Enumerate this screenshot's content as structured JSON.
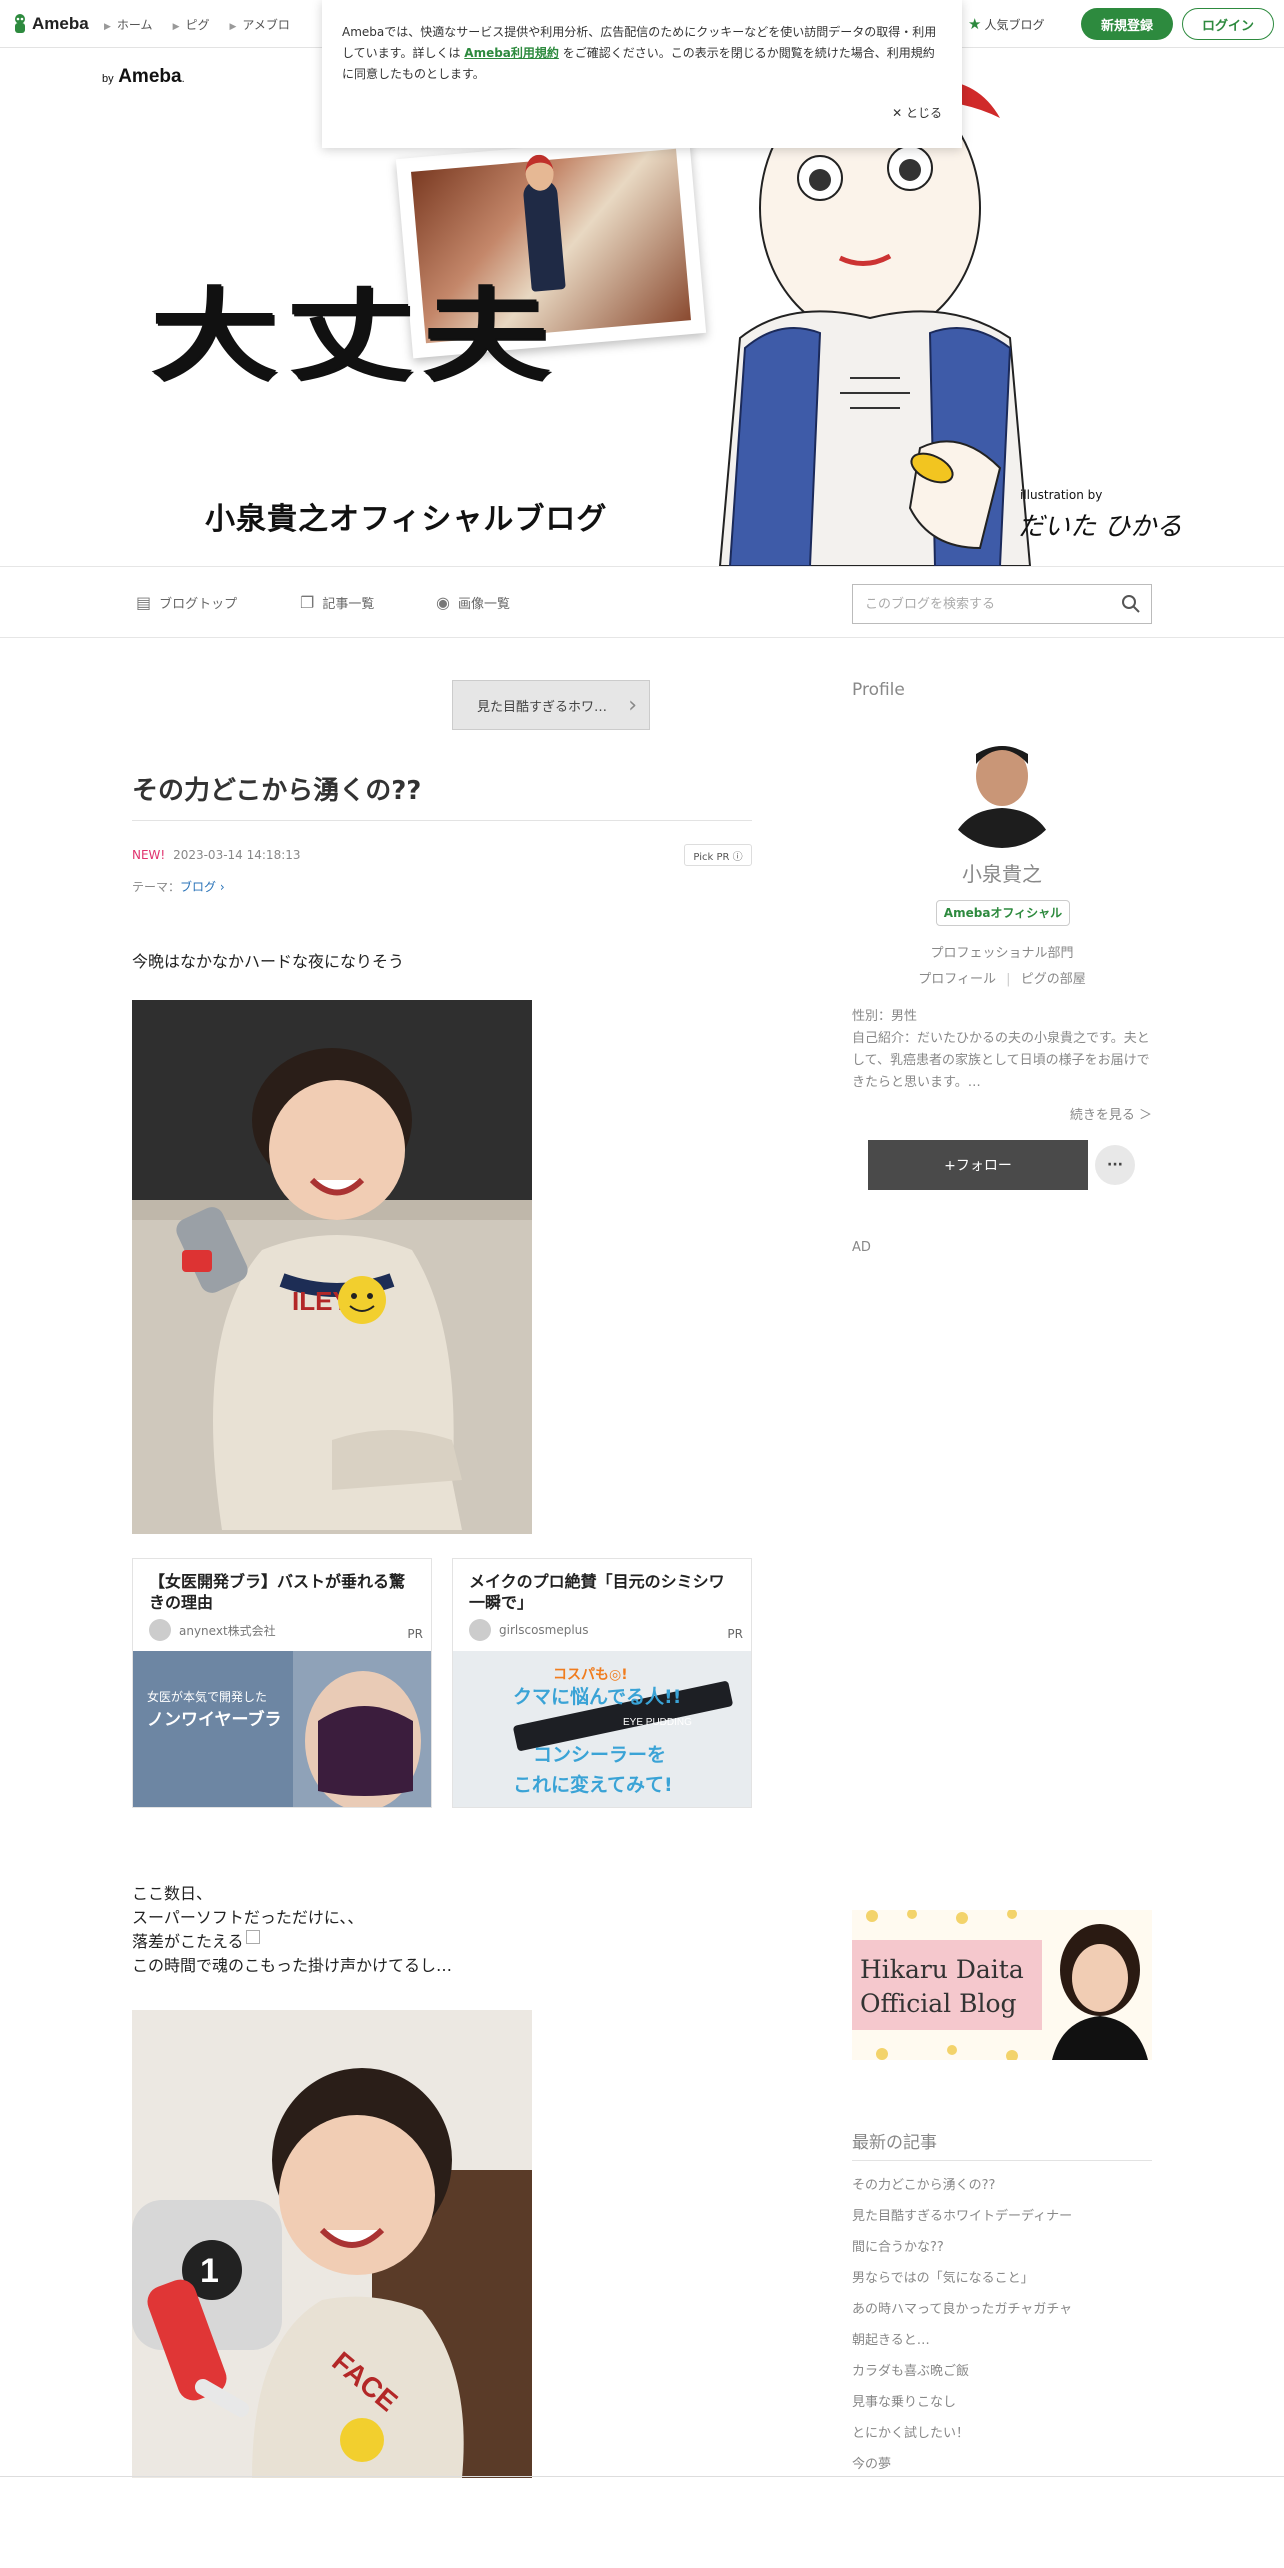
{
  "global_header": {
    "logo": "Ameba",
    "nav": [
      "ホーム",
      "ピグ",
      "アメブロ"
    ],
    "popular": "人気ブログ",
    "register": "新規登録",
    "login": "ログイン"
  },
  "cookie": {
    "text_before": "Amebaでは、快適なサービス提供や利用分析、広告配信のためにクッキーなどを使い訪問データの取得・利用しています。詳しくは",
    "link": "Ameba利用規約",
    "text_after": "をご確認ください。この表示を閉じるか閲覧を続けた場合、利用規約に同意したものとします。",
    "close": "とじる"
  },
  "banner": {
    "by": "by",
    "brand": "Ameba",
    "brand_dot": ".",
    "title": "大丈夫",
    "subtitle": "小泉貴之オフィシャルブログ",
    "illustration_by": "illustration by",
    "illustrator": "だいた ひかる"
  },
  "blognav": {
    "top": "ブログトップ",
    "list": "記事一覧",
    "images": "画像一覧",
    "search_placeholder": "このブログを検索する"
  },
  "article": {
    "prev": "見た目酷すぎるホワ…",
    "title": "その力どこから湧くの??",
    "new": "NEW!",
    "date": "2023-03-14 14:18:13",
    "pick": "Pick PR ⓘ",
    "theme_label": "テーマ：",
    "theme": "ブログ",
    "p1": "今晩はなかなかハードな夜になりそう",
    "p2_lines": [
      "ここ数日、",
      "スーパーソフトだっただけに、、",
      "落差がこたえる",
      "この時間で魂のこもった掛け声かけてるし…"
    ]
  },
  "pr": [
    {
      "title": "【女医開発ブラ】バストが垂れる驚きの理由",
      "source": "anynext株式会社",
      "label": "PR",
      "img_text": [
        "女医が本気で開発した",
        "ノンワイヤーブラ"
      ]
    },
    {
      "title": "メイクのプロ絶賛「目元のシミシワ一瞬で」",
      "source": "girlscosmeplus",
      "label": "PR",
      "img_text": [
        "コスパも◎!",
        "クマに悩んでる人!!",
        "EYE PUDDING",
        "コンシーラーを",
        "これに変えてみて!"
      ]
    }
  ],
  "sidebar": {
    "profile_heading": "Profile",
    "name": "小泉貴之",
    "official": "Amebaオフィシャル",
    "category": "プロフェッショナル部門",
    "link_profile": "プロフィール",
    "link_pig": "ピグの部屋",
    "gender": "性別：男性",
    "intro": "自己紹介：だいたひかるの夫の小泉貴之です。夫として、乳癌患者の家族として日頃の様子をお届けできたらと思います。…",
    "readmore": "続きを見る ＞",
    "follow": "+フォロー",
    "more": "···",
    "ad": "AD",
    "banner_line1": "Hikaru Daita",
    "banner_line2": "Official Blog",
    "latest_heading": "最新の記事",
    "latest": [
      "その力どこから湧くの??",
      "見た目酷すぎるホワイトデーディナー",
      "間に合うかな??",
      "男ならではの「気になること」",
      "あの時ハマって良かったガチャガチャ",
      "朝起きると…",
      "カラダも喜ぶ晩ご飯",
      "見事な乗りこなし",
      "とにかく試したい！",
      "今の夢"
    ]
  },
  "colors": {
    "brand_green": "#2d8a3e",
    "new_pink": "#e0336e",
    "link_blue": "#2a73b8"
  }
}
